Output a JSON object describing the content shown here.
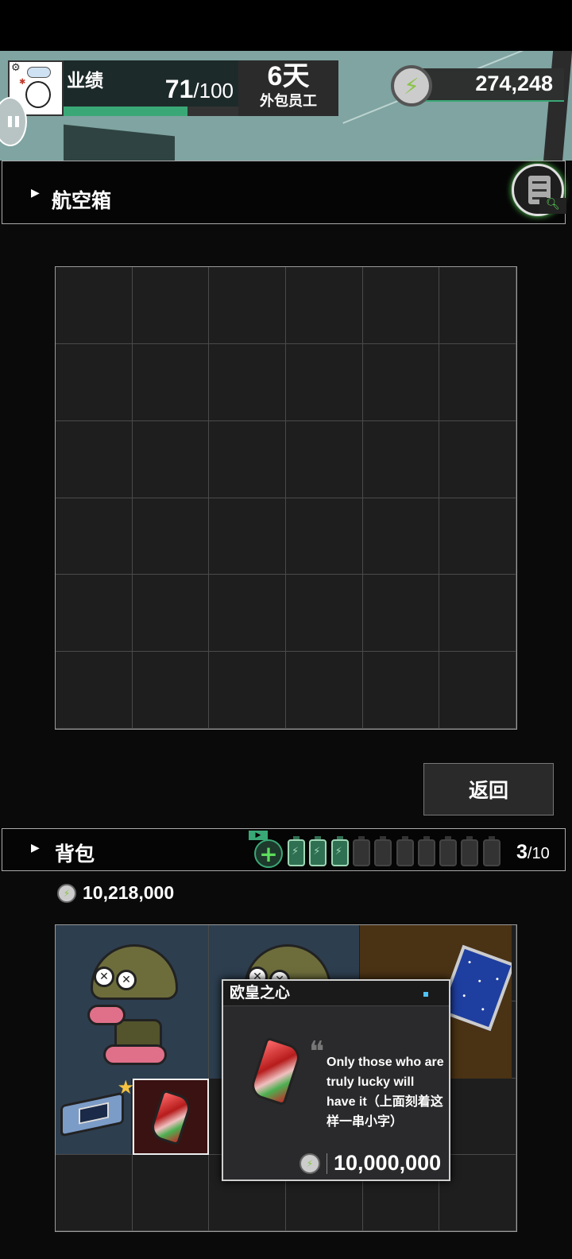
{
  "hud": {
    "performance_label": "业绩",
    "performance_value": "71",
    "performance_max": "/100",
    "performance_fill": 0.71,
    "days": "6天",
    "days_sub": "外包员工",
    "currency": "274,248"
  },
  "crate": {
    "title": "航空箱",
    "rows": 6,
    "cols": 6
  },
  "return_label": "返回",
  "backpack": {
    "title": "背包",
    "ad_badge": "▶",
    "plus_icon": "+",
    "batteries_filled": 3,
    "batteries_total": 10,
    "count": "3",
    "count_max": "/10",
    "money": "10,218,000",
    "rows": 4,
    "cols": 6
  },
  "tooltip": {
    "title": "欧皇之心",
    "description": "Only those who are truly lucky will have it（上面刻着这样一串小字）",
    "price": "10,000,000"
  },
  "colors": {
    "accent_green": "#3aa876",
    "hud_bg": "#7fa4a1",
    "cell_bg": "#1e1e1e"
  }
}
